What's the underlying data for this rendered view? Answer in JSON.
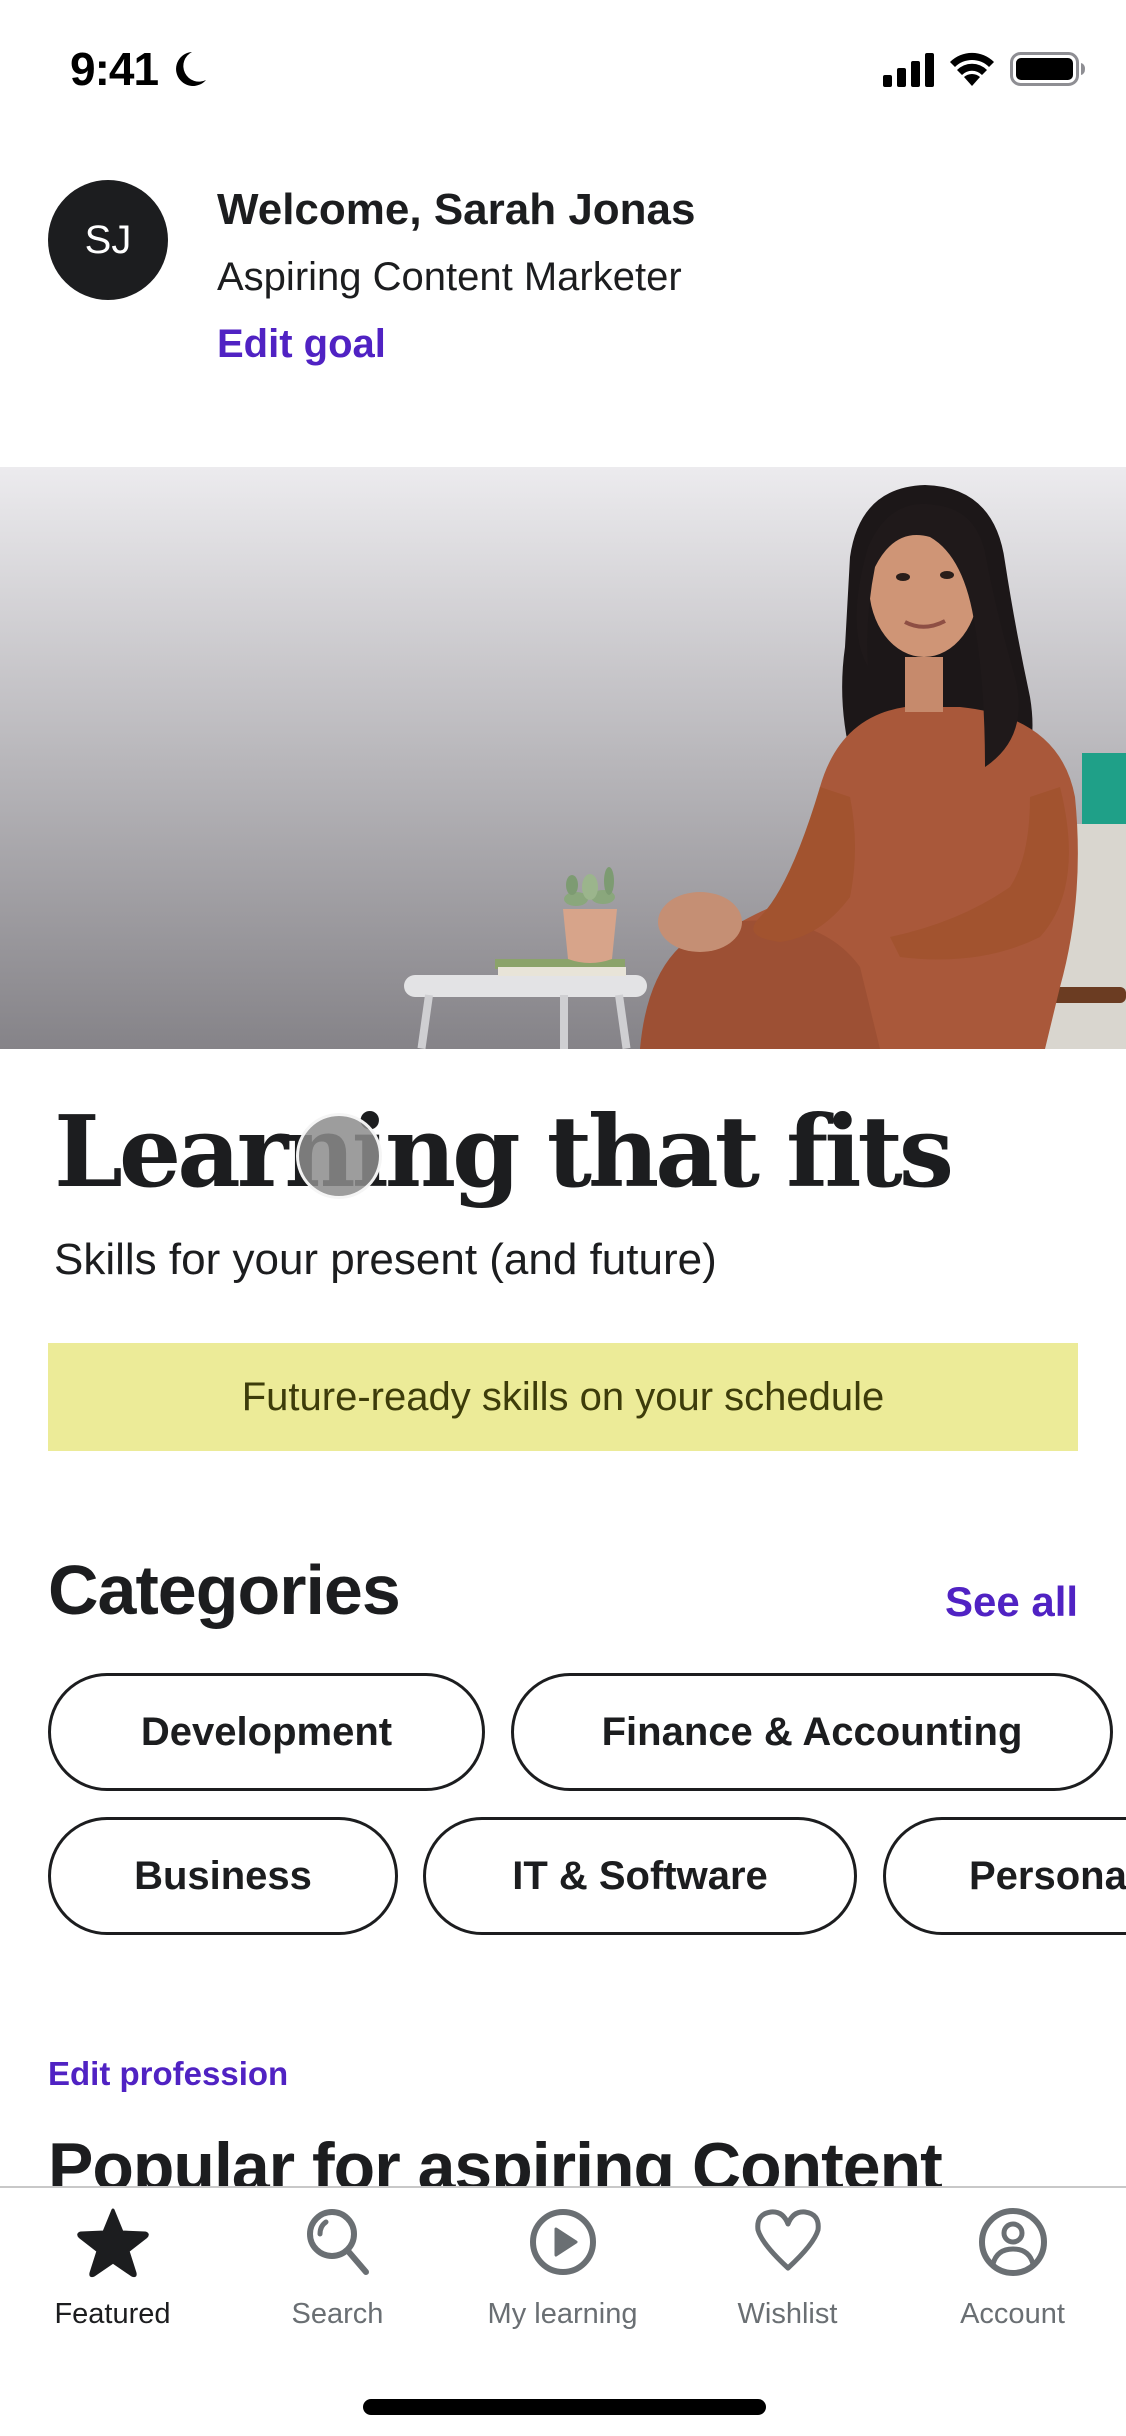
{
  "status_bar": {
    "time": "9:41",
    "icons": [
      "moon-icon",
      "signal-icon",
      "wifi-icon",
      "battery-icon"
    ]
  },
  "header": {
    "avatar_initials": "SJ",
    "welcome": "Welcome, Sarah Jonas",
    "goal": "Aspiring Content Marketer",
    "edit_goal_label": "Edit goal"
  },
  "hero": {
    "headline": "Learning that fits",
    "subheadline": "Skills for your present (and future)",
    "banner_text": "Future-ready skills on your schedule"
  },
  "categories": {
    "title": "Categories",
    "see_all_label": "See all",
    "items": [
      "Development",
      "Finance & Accounting",
      "Business",
      "IT & Software",
      "Personal Development"
    ],
    "visible_text": {
      "personal": "Persona"
    }
  },
  "profession": {
    "edit_label": "Edit profession",
    "popular_title": "Popular for aspiring Content"
  },
  "bottom_nav": {
    "items": [
      {
        "label": "Featured",
        "icon": "star-icon",
        "active": true
      },
      {
        "label": "Search",
        "icon": "search-icon",
        "active": false
      },
      {
        "label": "My learning",
        "icon": "play-circle-icon",
        "active": false
      },
      {
        "label": "Wishlist",
        "icon": "heart-icon",
        "active": false
      },
      {
        "label": "Account",
        "icon": "account-icon",
        "active": false
      }
    ]
  },
  "colors": {
    "accent_purple": "#5022c3",
    "text_dark": "#1c1d1f",
    "banner_yellow": "#eceb98",
    "nav_inactive": "#6a6f73"
  }
}
